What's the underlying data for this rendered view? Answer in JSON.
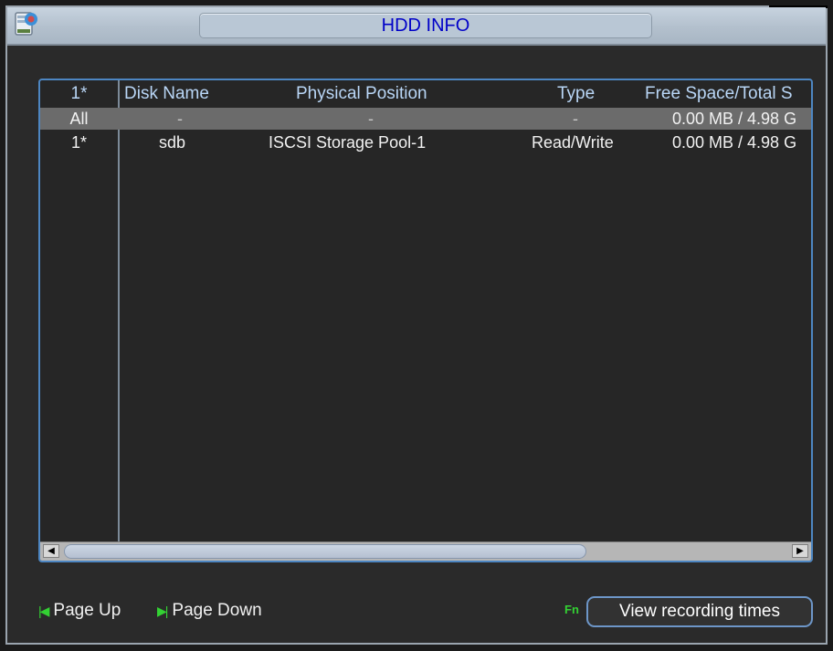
{
  "window": {
    "title": "HDD INFO"
  },
  "table": {
    "headers": [
      "1*",
      "Disk Name",
      "Physical Position",
      "Type",
      "Free Space/Total S"
    ],
    "rows": [
      [
        "All",
        "-",
        "-",
        "-",
        "0.00 MB / 4.98 G"
      ],
      [
        "1*",
        "sdb",
        "ISCSI Storage Pool-1",
        "Read/Write",
        "0.00 MB / 4.98 G"
      ]
    ]
  },
  "footer": {
    "page_up": "Page Up",
    "page_down": "Page Down",
    "fn_label": "Fn",
    "view_recording_times": "View recording times"
  },
  "icons": {
    "app": "hdd-info-icon",
    "page_up": "skip-back-icon",
    "page_down": "skip-forward-icon"
  },
  "colors": {
    "title_text": "#0000c8",
    "header_text": "#b9d6f6",
    "accent_green": "#33d133",
    "border_blue": "#4d86c2"
  }
}
